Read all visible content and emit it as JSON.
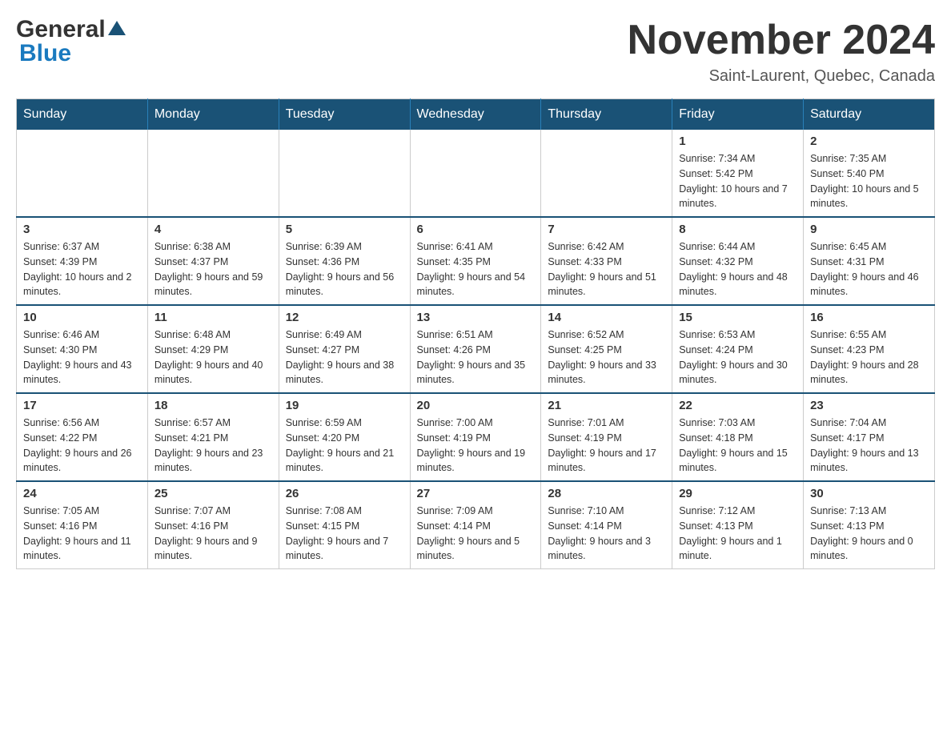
{
  "header": {
    "logo_general": "General",
    "logo_blue": "Blue",
    "month_title": "November 2024",
    "subtitle": "Saint-Laurent, Quebec, Canada"
  },
  "days_of_week": [
    "Sunday",
    "Monday",
    "Tuesday",
    "Wednesday",
    "Thursday",
    "Friday",
    "Saturday"
  ],
  "weeks": [
    [
      {
        "day": "",
        "info": ""
      },
      {
        "day": "",
        "info": ""
      },
      {
        "day": "",
        "info": ""
      },
      {
        "day": "",
        "info": ""
      },
      {
        "day": "",
        "info": ""
      },
      {
        "day": "1",
        "info": "Sunrise: 7:34 AM\nSunset: 5:42 PM\nDaylight: 10 hours and 7 minutes."
      },
      {
        "day": "2",
        "info": "Sunrise: 7:35 AM\nSunset: 5:40 PM\nDaylight: 10 hours and 5 minutes."
      }
    ],
    [
      {
        "day": "3",
        "info": "Sunrise: 6:37 AM\nSunset: 4:39 PM\nDaylight: 10 hours and 2 minutes."
      },
      {
        "day": "4",
        "info": "Sunrise: 6:38 AM\nSunset: 4:37 PM\nDaylight: 9 hours and 59 minutes."
      },
      {
        "day": "5",
        "info": "Sunrise: 6:39 AM\nSunset: 4:36 PM\nDaylight: 9 hours and 56 minutes."
      },
      {
        "day": "6",
        "info": "Sunrise: 6:41 AM\nSunset: 4:35 PM\nDaylight: 9 hours and 54 minutes."
      },
      {
        "day": "7",
        "info": "Sunrise: 6:42 AM\nSunset: 4:33 PM\nDaylight: 9 hours and 51 minutes."
      },
      {
        "day": "8",
        "info": "Sunrise: 6:44 AM\nSunset: 4:32 PM\nDaylight: 9 hours and 48 minutes."
      },
      {
        "day": "9",
        "info": "Sunrise: 6:45 AM\nSunset: 4:31 PM\nDaylight: 9 hours and 46 minutes."
      }
    ],
    [
      {
        "day": "10",
        "info": "Sunrise: 6:46 AM\nSunset: 4:30 PM\nDaylight: 9 hours and 43 minutes."
      },
      {
        "day": "11",
        "info": "Sunrise: 6:48 AM\nSunset: 4:29 PM\nDaylight: 9 hours and 40 minutes."
      },
      {
        "day": "12",
        "info": "Sunrise: 6:49 AM\nSunset: 4:27 PM\nDaylight: 9 hours and 38 minutes."
      },
      {
        "day": "13",
        "info": "Sunrise: 6:51 AM\nSunset: 4:26 PM\nDaylight: 9 hours and 35 minutes."
      },
      {
        "day": "14",
        "info": "Sunrise: 6:52 AM\nSunset: 4:25 PM\nDaylight: 9 hours and 33 minutes."
      },
      {
        "day": "15",
        "info": "Sunrise: 6:53 AM\nSunset: 4:24 PM\nDaylight: 9 hours and 30 minutes."
      },
      {
        "day": "16",
        "info": "Sunrise: 6:55 AM\nSunset: 4:23 PM\nDaylight: 9 hours and 28 minutes."
      }
    ],
    [
      {
        "day": "17",
        "info": "Sunrise: 6:56 AM\nSunset: 4:22 PM\nDaylight: 9 hours and 26 minutes."
      },
      {
        "day": "18",
        "info": "Sunrise: 6:57 AM\nSunset: 4:21 PM\nDaylight: 9 hours and 23 minutes."
      },
      {
        "day": "19",
        "info": "Sunrise: 6:59 AM\nSunset: 4:20 PM\nDaylight: 9 hours and 21 minutes."
      },
      {
        "day": "20",
        "info": "Sunrise: 7:00 AM\nSunset: 4:19 PM\nDaylight: 9 hours and 19 minutes."
      },
      {
        "day": "21",
        "info": "Sunrise: 7:01 AM\nSunset: 4:19 PM\nDaylight: 9 hours and 17 minutes."
      },
      {
        "day": "22",
        "info": "Sunrise: 7:03 AM\nSunset: 4:18 PM\nDaylight: 9 hours and 15 minutes."
      },
      {
        "day": "23",
        "info": "Sunrise: 7:04 AM\nSunset: 4:17 PM\nDaylight: 9 hours and 13 minutes."
      }
    ],
    [
      {
        "day": "24",
        "info": "Sunrise: 7:05 AM\nSunset: 4:16 PM\nDaylight: 9 hours and 11 minutes."
      },
      {
        "day": "25",
        "info": "Sunrise: 7:07 AM\nSunset: 4:16 PM\nDaylight: 9 hours and 9 minutes."
      },
      {
        "day": "26",
        "info": "Sunrise: 7:08 AM\nSunset: 4:15 PM\nDaylight: 9 hours and 7 minutes."
      },
      {
        "day": "27",
        "info": "Sunrise: 7:09 AM\nSunset: 4:14 PM\nDaylight: 9 hours and 5 minutes."
      },
      {
        "day": "28",
        "info": "Sunrise: 7:10 AM\nSunset: 4:14 PM\nDaylight: 9 hours and 3 minutes."
      },
      {
        "day": "29",
        "info": "Sunrise: 7:12 AM\nSunset: 4:13 PM\nDaylight: 9 hours and 1 minute."
      },
      {
        "day": "30",
        "info": "Sunrise: 7:13 AM\nSunset: 4:13 PM\nDaylight: 9 hours and 0 minutes."
      }
    ]
  ]
}
